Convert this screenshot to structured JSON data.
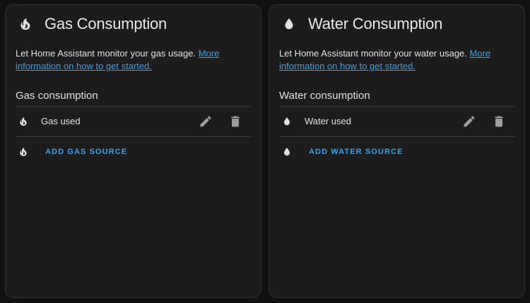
{
  "colors": {
    "accent": "#2ea6f3",
    "card_background": "#1c1c1c",
    "page_background": "#111111",
    "icon": "#e1e1e1",
    "action_icon": "#9e9e9e"
  },
  "gas": {
    "icon": "fire-icon",
    "title": "Gas Consumption",
    "description": "Let Home Assistant monitor your gas usage.",
    "link_text": "More information on how to get started.",
    "section_title": "Gas consumption",
    "sources": [
      {
        "label": "Gas used",
        "icon": "fire-icon"
      }
    ],
    "add_label": "ADD GAS SOURCE"
  },
  "water": {
    "icon": "water-drop-icon",
    "title": "Water Consumption",
    "description": "Let Home Assistant monitor your water usage.",
    "link_text": "More information on how to get started.",
    "section_title": "Water consumption",
    "sources": [
      {
        "label": "Water used",
        "icon": "water-drop-icon"
      }
    ],
    "add_label": "ADD WATER SOURCE"
  }
}
